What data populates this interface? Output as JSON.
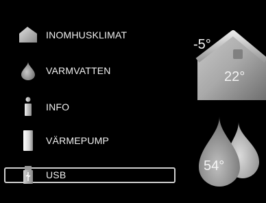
{
  "menu": {
    "items": [
      {
        "label": "INOMHUSKLIMAT",
        "icon": "house-icon",
        "selected": false
      },
      {
        "label": "VARMVATTEN",
        "icon": "water-drop-icon",
        "selected": false
      },
      {
        "label": "INFO",
        "icon": "info-icon",
        "selected": false
      },
      {
        "label": "VÄRMEPUMP",
        "icon": "heat-pump-icon",
        "selected": false
      },
      {
        "label": "USB",
        "icon": "usb-icon",
        "selected": true
      }
    ]
  },
  "status": {
    "outdoor_temp": "-5°",
    "indoor_temp": "22°",
    "hot_water_temp": "54°"
  }
}
